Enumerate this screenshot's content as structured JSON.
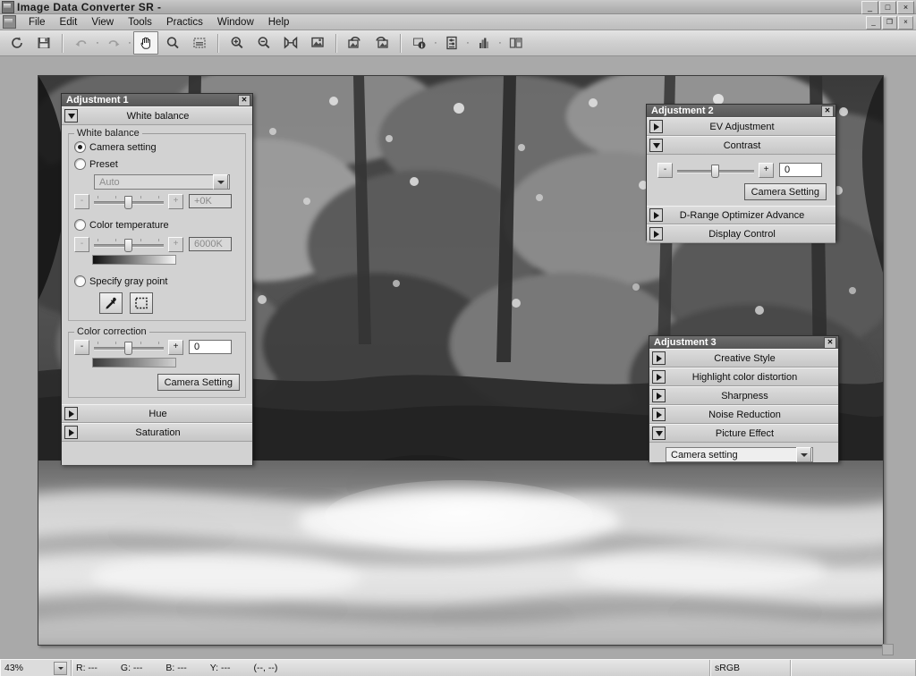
{
  "window": {
    "title": "Image Data Converter SR -",
    "app_icon": "app-icon",
    "controls": {
      "minimize": "_",
      "maximize": "□",
      "close": "×"
    },
    "mdi_controls": {
      "minimize": "_",
      "restore": "❐",
      "close": "×"
    }
  },
  "menu": {
    "items": [
      {
        "label": "File"
      },
      {
        "label": "Edit"
      },
      {
        "label": "View"
      },
      {
        "label": "Tools"
      },
      {
        "label": "Practics"
      },
      {
        "label": "Window"
      },
      {
        "label": "Help"
      }
    ]
  },
  "toolbar": {
    "buttons": [
      {
        "name": "refresh-icon",
        "state": "enabled"
      },
      {
        "name": "save-icon",
        "state": "enabled"
      },
      {
        "name": "undo-icon",
        "state": "disabled"
      },
      {
        "name": "redo-icon",
        "state": "disabled"
      },
      {
        "name": "hand-tool-icon",
        "state": "active"
      },
      {
        "name": "magnifier-icon",
        "state": "enabled"
      },
      {
        "name": "crop-select-icon",
        "state": "enabled"
      },
      {
        "name": "zoom-in-icon",
        "state": "enabled"
      },
      {
        "name": "zoom-out-icon",
        "state": "enabled"
      },
      {
        "name": "fit-to-window-icon",
        "state": "enabled"
      },
      {
        "name": "actual-pixels-icon",
        "state": "enabled"
      },
      {
        "name": "rotate-left-icon",
        "state": "enabled"
      },
      {
        "name": "rotate-right-icon",
        "state": "enabled"
      },
      {
        "name": "image-info-icon",
        "state": "enabled"
      },
      {
        "name": "adjust-levels-icon",
        "state": "enabled"
      },
      {
        "name": "histogram-icon",
        "state": "enabled"
      },
      {
        "name": "compare-view-icon",
        "state": "enabled"
      }
    ]
  },
  "adjustment1": {
    "title": "Adjustment 1",
    "close": "✕",
    "sections": [
      {
        "label": "White balance",
        "expanded": true
      },
      {
        "label": "Hue",
        "expanded": false
      },
      {
        "label": "Saturation",
        "expanded": false
      }
    ],
    "white_balance": {
      "group_label": "White balance",
      "camera_setting": {
        "label": "Camera setting",
        "selected": true
      },
      "preset": {
        "label": "Preset",
        "selected": false
      },
      "preset_combo": {
        "value": "Auto",
        "enabled": false
      },
      "preset_slider": {
        "value": "+0K",
        "enabled": false,
        "minus": "-",
        "plus": "+",
        "thumb_pct": 48
      },
      "color_temperature": {
        "label": "Color temperature",
        "selected": false
      },
      "temp_field": {
        "value": "6000K",
        "enabled": false,
        "minus": "-",
        "plus": "+",
        "thumb_pct": 48
      },
      "specify_gray_point": {
        "label": "Specify gray point",
        "selected": false
      },
      "eyedropper": "eyedropper-icon",
      "marquee": "marquee-select-icon"
    },
    "color_correction": {
      "group_label": "Color correction",
      "value": "0",
      "minus": "-",
      "plus": "+",
      "thumb_pct": 48,
      "camera_setting_button": "Camera Setting"
    }
  },
  "adjustment2": {
    "title": "Adjustment 2",
    "close": "✕",
    "sections": [
      {
        "label": "EV Adjustment",
        "expanded": false
      },
      {
        "label": "Contrast",
        "expanded": true
      },
      {
        "label": "D-Range Optimizer Advance",
        "expanded": false
      },
      {
        "label": "Display Control",
        "expanded": false
      }
    ],
    "contrast": {
      "value": "0",
      "minus": "-",
      "plus": "+",
      "thumb_pct": 48,
      "camera_setting_button": "Camera Setting"
    }
  },
  "adjustment3": {
    "title": "Adjustment 3",
    "close": "✕",
    "sections": [
      {
        "label": "Creative Style",
        "expanded": false
      },
      {
        "label": "Highlight color distortion",
        "expanded": false
      },
      {
        "label": "Sharpness",
        "expanded": false
      },
      {
        "label": "Noise Reduction",
        "expanded": false
      },
      {
        "label": "Picture Effect",
        "expanded": true
      }
    ],
    "picture_effect_combo": {
      "value": "Camera setting"
    }
  },
  "statusbar": {
    "zoom": "43%",
    "readout": {
      "r": "R: ---",
      "g": "G: ---",
      "b": "B: ---",
      "y": "Y: ---",
      "coords": "(--, --)"
    },
    "color_space": "sRGB"
  }
}
